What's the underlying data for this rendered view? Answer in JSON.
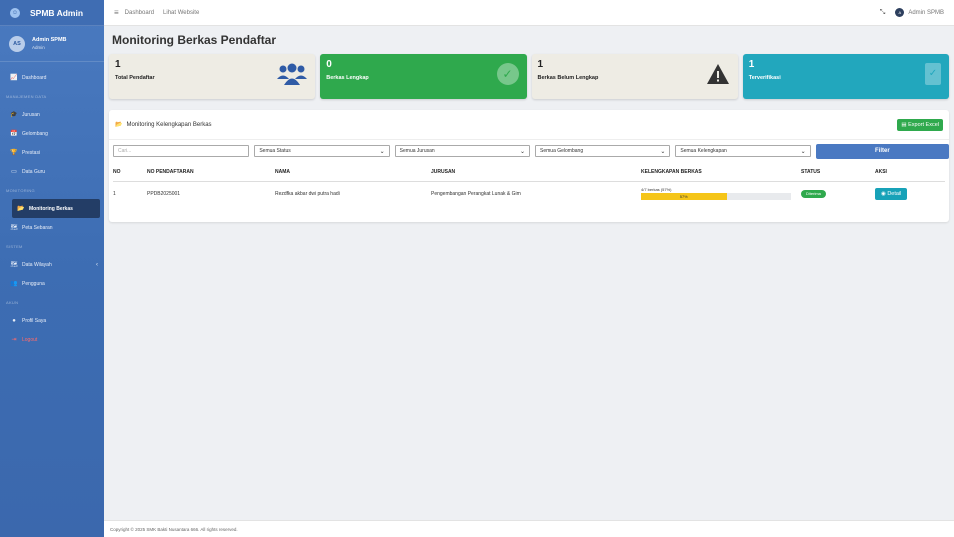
{
  "brand": {
    "logo": "☺",
    "name": "SPMB Admin"
  },
  "user": {
    "initials": "AS",
    "name": "Admin SPMB",
    "role": "Admin"
  },
  "nav": [
    {
      "type": "item",
      "icon": "chart-line-icon",
      "glyph": "📈",
      "label": "Dashboard"
    },
    {
      "type": "header",
      "label": "MANAJEMEN DATA"
    },
    {
      "type": "item",
      "icon": "graduation-cap-icon",
      "glyph": "🎓",
      "label": "Jurusan"
    },
    {
      "type": "item",
      "icon": "calendar-icon",
      "glyph": "📅",
      "label": "Gelombang"
    },
    {
      "type": "item",
      "icon": "trophy-icon",
      "glyph": "🏆",
      "label": "Prestasi"
    },
    {
      "type": "item",
      "icon": "chalkboard-icon",
      "glyph": "▭",
      "label": "Data Guru"
    },
    {
      "type": "header",
      "label": "MONITORING"
    },
    {
      "type": "item",
      "icon": "folder-open-icon",
      "glyph": "📂",
      "label": "Monitoring Berkas",
      "active": true
    },
    {
      "type": "item",
      "icon": "map-icon",
      "glyph": "🗺",
      "label": "Peta Sebaran"
    },
    {
      "type": "header",
      "label": "SISTEM"
    },
    {
      "type": "item",
      "icon": "map-marked-icon",
      "glyph": "🗺",
      "label": "Data Wilayah",
      "chevron": true
    },
    {
      "type": "item",
      "icon": "users-cog-icon",
      "glyph": "👥",
      "label": "Pengguna"
    },
    {
      "type": "header",
      "label": "AKUN"
    },
    {
      "type": "item",
      "icon": "user-circle-icon",
      "glyph": "●",
      "label": "Profil Saya"
    },
    {
      "type": "item",
      "icon": "logout-icon",
      "glyph": "⇥",
      "label": "Logout",
      "logout": true
    }
  ],
  "topbar": {
    "dashboard": "Dashboard",
    "website": "Lihat Website",
    "user": "Admin SPMB",
    "avatar": "A"
  },
  "page_title": "Monitoring Berkas Pendaftar",
  "cards": [
    {
      "value": "1",
      "label": "Total Pendaftar",
      "icon": "users-icon"
    },
    {
      "value": "0",
      "label": "Berkas Lengkap",
      "icon": "check-circle-icon"
    },
    {
      "value": "1",
      "label": "Berkas Belum Lengkap",
      "icon": "warning-icon"
    },
    {
      "value": "1",
      "label": "Terverifikasi",
      "icon": "clipboard-check-icon"
    }
  ],
  "panel": {
    "title": "Monitoring Kelengkapan Berkas",
    "export_label": "Export Excel"
  },
  "filters": {
    "search_placeholder": "Cari...",
    "status": "Semua Status",
    "jurusan": "Semua Jurusan",
    "gelombang": "Semua Gelombang",
    "kelengkapan": "Semua Kelengkapan",
    "filter_label": "Filter"
  },
  "table": {
    "headers": [
      "NO",
      "NO PENDAFTARAN",
      "NAMA",
      "JURUSAN",
      "KELENGKAPAN BERKAS",
      "STATUS",
      "AKSI"
    ],
    "rows": [
      {
        "no": "1",
        "no_pendaftaran": "PPDB2025001",
        "nama": "Rezdfka akbar dwi putra hadi",
        "jurusan": "Pengembangan Perangkat Lunak & Gim",
        "kelengkapan_text": "4/7 berkas (57%)",
        "kelengkapan_pct": 57,
        "kelengkapan_label": "57%",
        "status": "Diterima",
        "aksi": "Detail"
      }
    ]
  },
  "footer": "Copyright © 2025 SMK Bakti Nusantara 666. All rights reserved."
}
